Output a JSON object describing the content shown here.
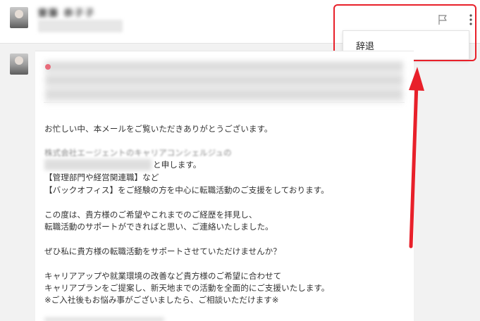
{
  "header": {
    "sender_name": "齋藤 恭子子",
    "flag_icon": "flag-icon",
    "more_icon": "more-vertical-icon"
  },
  "dropdown": {
    "items": [
      {
        "label": "辞退"
      }
    ]
  },
  "message": {
    "lines": [
      "お忙しい中、本メールをご覧いただきありがとうございます。",
      "株式会社エージェントのキャリアコンシェルジュの",
      "と申します。",
      "【管理部門や経営関連職】など",
      "【バックオフィス】をご経験の方を中心に転職活動のご支援をしております。",
      "この度は、貴方様のご希望やこれまでのご経歴を拝見し、",
      "転職活動のサポートができればと思い、ご連絡いたしました。",
      "ぜひ私に貴方様の転職活動をサポートさせていただけませんか？",
      "キャリアアップや就業環境の改善など貴方様のご希望に合わせて",
      "キャリアプランをご提案し、新天地までの活動を全面的にご支援いたします。",
      "※ご入社後もお悩み事がございましたら、ご相談いただけます※"
    ]
  },
  "colors": {
    "annotation_red": "#e8202a",
    "background": "#f2f2f2"
  }
}
